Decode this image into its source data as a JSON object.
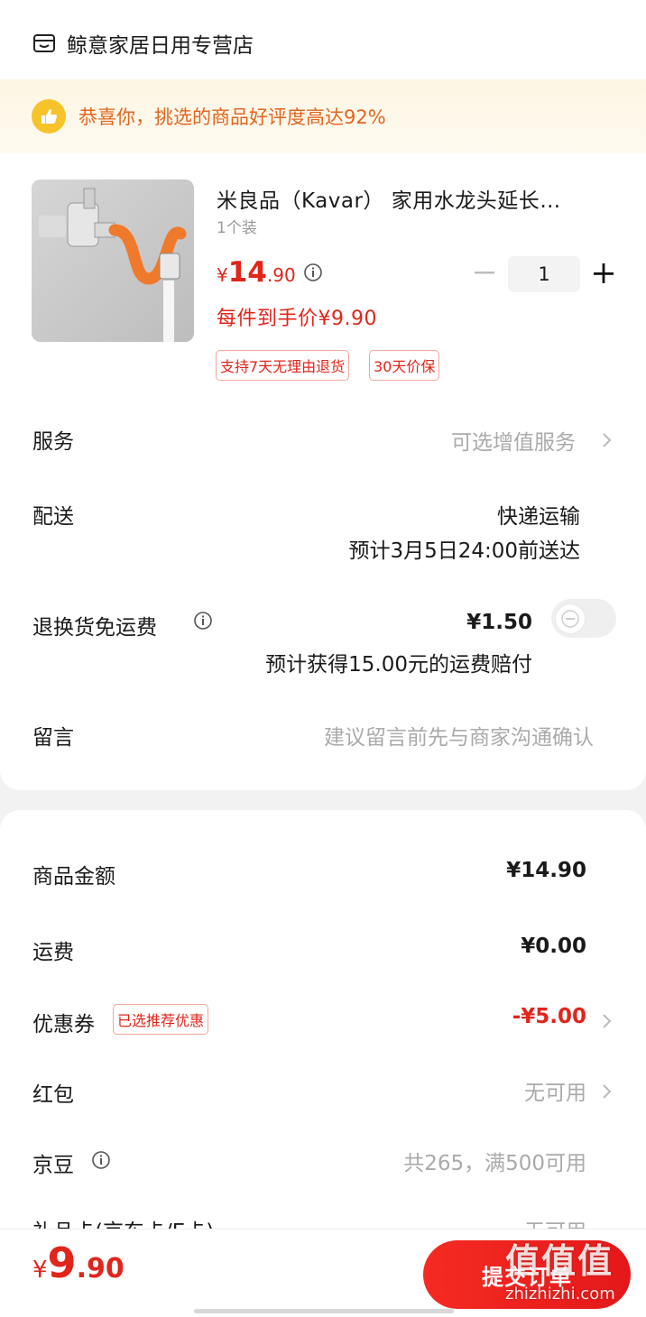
{
  "store": {
    "name": "鲸意家居日用专营店",
    "icon": "store-icon"
  },
  "banner": {
    "text": "恭喜你，挑选的商品好评度高达92%",
    "icon": "thumbs-up-icon"
  },
  "product": {
    "title": "米良品（Kavar） 家用水龙头延长…",
    "spec": "1个装",
    "price_currency": "¥",
    "price_int": "14",
    "price_dec": ".90",
    "hand_price": "每件到手价¥9.90",
    "tags": [
      "支持7天无理由退货",
      "30天价保"
    ],
    "quantity": "1"
  },
  "service": {
    "label": "服务",
    "value": "可选增值服务"
  },
  "delivery": {
    "label": "配送",
    "method": "快递运输",
    "eta": "预计3月5日24:00前送达"
  },
  "return_insurance": {
    "label": "退换货免运费",
    "price": "¥1.50",
    "note": "预计获得15.00元的运费赔付",
    "enabled": false
  },
  "message": {
    "label": "留言",
    "placeholder": "建议留言前先与商家沟通确认"
  },
  "summary": {
    "goods_amount_label": "商品金额",
    "goods_amount": "¥14.90",
    "shipping_label": "运费",
    "shipping": "¥0.00",
    "coupon_label": "优惠券",
    "coupon_badge": "已选推荐优惠",
    "coupon_value": "-¥5.00",
    "redpacket_label": "红包",
    "redpacket_value": "无可用",
    "jingdou_label": "京豆",
    "jingdou_value": "共265，满500可用",
    "giftcard_label": "礼品卡(京东卡/E卡)",
    "giftcard_value": "无可用"
  },
  "footer": {
    "total_currency": "¥",
    "total_int": "9",
    "total_dec": ".90",
    "submit_label": "提交订单"
  },
  "watermark": {
    "main": "值值值",
    "sub": "zhizhizhi.com"
  },
  "colors": {
    "accent": "#e1251b",
    "banner_text": "#e2651f",
    "banner_bg": "#fdf6e3",
    "hose": "#f07a2c"
  }
}
